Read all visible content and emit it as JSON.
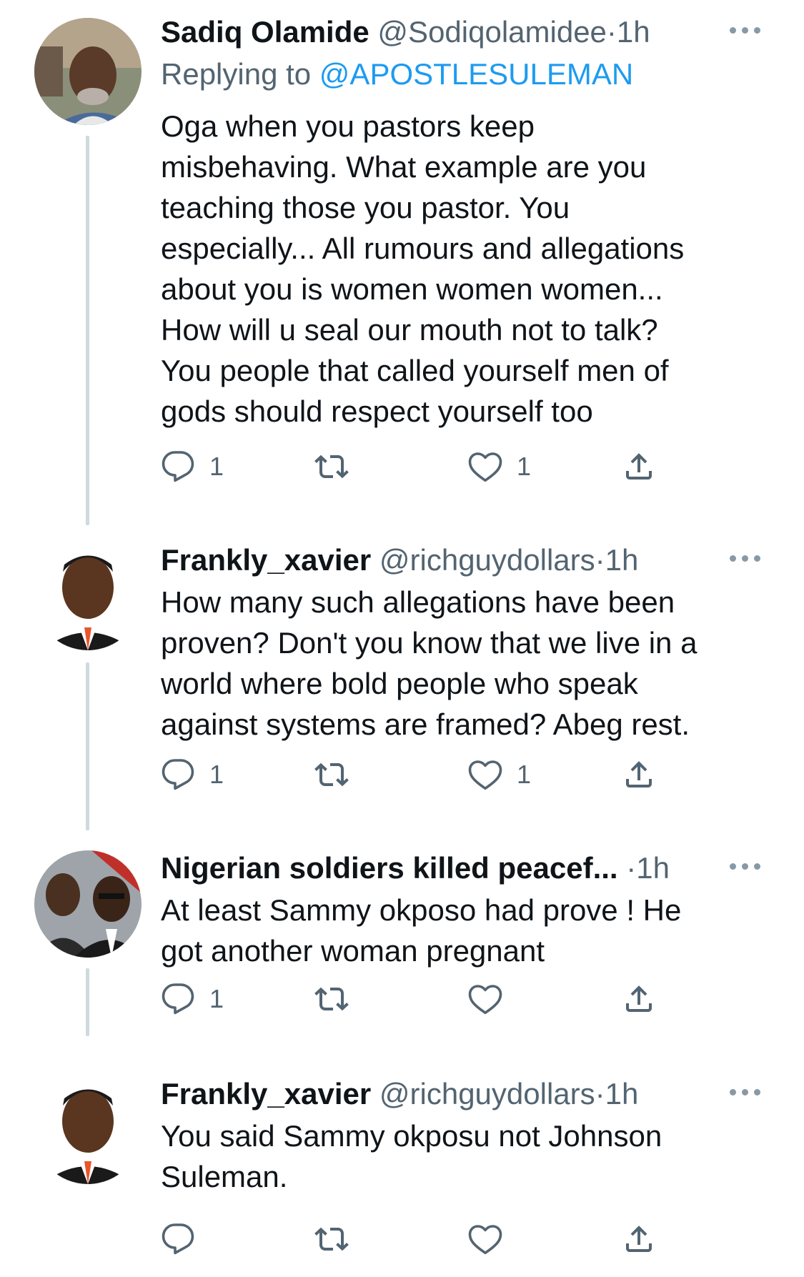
{
  "tweets": [
    {
      "name": "Sadiq Olamide",
      "handle": "@Sodiqolamidee",
      "dot": "·",
      "time": "1h",
      "replying_label": "Replying to",
      "replying_to": "@APOSTLESULEMAN",
      "text_lines": [
        "Oga when you pastors keep",
        "misbehaving. What example are you",
        "teaching those you pastor. You",
        "especially... All rumours and allegations",
        "about you is women women women...",
        "How will u seal our mouth not to talk?",
        "You people that called yourself men of",
        "gods should respect yourself too"
      ],
      "reply_count": "1",
      "retweet_count": "",
      "like_count": "1"
    },
    {
      "name": "Frankly_xavier",
      "handle": "@richguydollars",
      "dot": "·",
      "time": "1h",
      "text_lines": [
        "How many such allegations have been",
        "proven? Don't you know that we live in a",
        "world where bold people who speak",
        "against systems are framed? Abeg rest."
      ],
      "reply_count": "1",
      "retweet_count": "",
      "like_count": "1"
    },
    {
      "name": "Nigerian soldiers killed peacef...",
      "handle": "",
      "dot": "·",
      "time": "1h",
      "text_lines": [
        "At least Sammy okposo had prove ! He",
        "got another woman pregnant"
      ],
      "reply_count": "1",
      "retweet_count": "",
      "like_count": ""
    },
    {
      "name": "Frankly_xavier",
      "handle": "@richguydollars",
      "dot": "·",
      "time": "1h",
      "text_lines": [
        "You said Sammy okposu not Johnson",
        "Suleman."
      ],
      "reply_count": "",
      "retweet_count": "",
      "like_count": ""
    }
  ],
  "icons": {
    "reply": "reply-icon",
    "retweet": "retweet-icon",
    "like": "heart-icon",
    "share": "share-icon",
    "more": "more-options-icon"
  },
  "colors": {
    "text": "#0f1419",
    "secondary": "#536471",
    "link": "#1d9bf0",
    "thread_line": "#cfd9de"
  }
}
